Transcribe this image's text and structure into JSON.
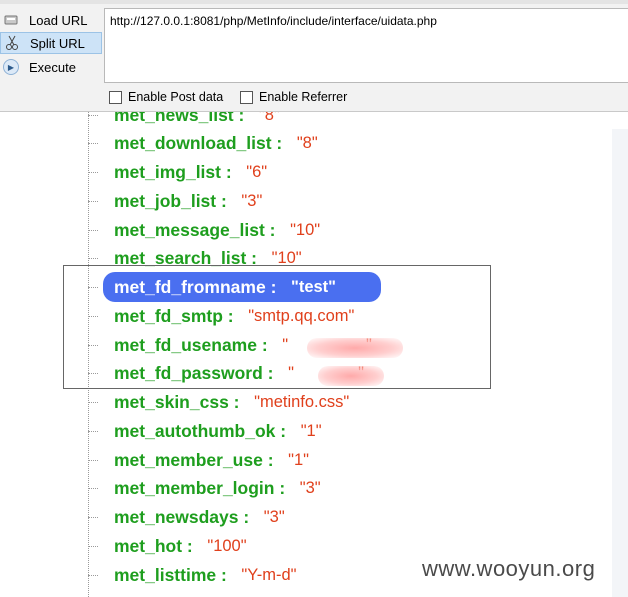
{
  "toolbar": {
    "load_url": "Load URL",
    "split_url": "Split URL",
    "execute": "Execute",
    "url": "http://127.0.0.1:8081/php/MetInfo/include/interface/uidata.php",
    "enable_post": "Enable Post data",
    "enable_referrer": "Enable Referrer"
  },
  "tree": {
    "rows": [
      {
        "key": "met_news_list",
        "value": "\"8\""
      },
      {
        "key": "met_download_list",
        "value": "\"8\""
      },
      {
        "key": "met_img_list",
        "value": "\"6\""
      },
      {
        "key": "met_job_list",
        "value": "\"3\""
      },
      {
        "key": "met_message_list",
        "value": "\"10\""
      },
      {
        "key": "met_search_list",
        "value": "\"10\""
      },
      {
        "key": "met_fd_fromname",
        "value": "\"test\""
      },
      {
        "key": "met_fd_smtp",
        "value": "\"smtp.qq.com\""
      },
      {
        "key": "met_fd_usename",
        "value": "\"                 \""
      },
      {
        "key": "met_fd_password",
        "value": "\"              \""
      },
      {
        "key": "met_skin_css",
        "value": "\"metinfo.css\""
      },
      {
        "key": "met_autothumb_ok",
        "value": "\"1\""
      },
      {
        "key": "met_member_use",
        "value": "\"1\""
      },
      {
        "key": "met_member_login",
        "value": "\"3\""
      },
      {
        "key": "met_newsdays",
        "value": "\"3\""
      },
      {
        "key": "met_hot",
        "value": "\"100\""
      },
      {
        "key": "met_listtime",
        "value": "\"Y-m-d\""
      }
    ],
    "separator": " :   ",
    "highlight_color": "#4a6ff0",
    "key_color": "#1e9e1e",
    "value_color": "#e0401c"
  },
  "watermark": "www.wooyun.org"
}
